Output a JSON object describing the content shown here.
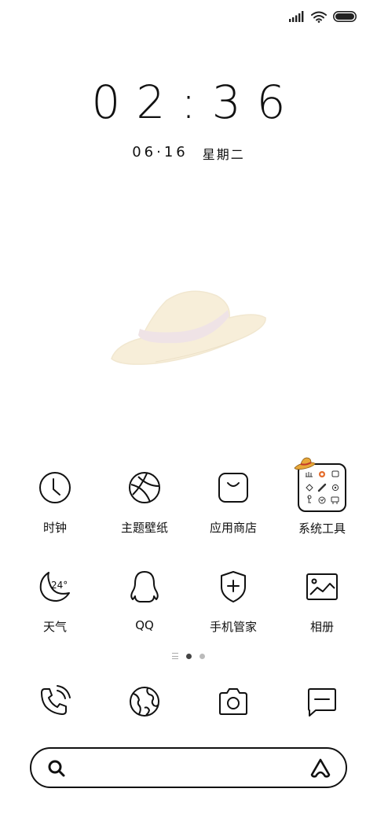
{
  "status_bar": {
    "signal_icon": "cellular-signal-icon",
    "wifi_icon": "wifi-icon",
    "battery_icon": "battery-icon"
  },
  "lock": {
    "time": "02:36",
    "date": "06·16",
    "weekday": "星期二"
  },
  "wallpaper": {
    "decoration": "straw-hat-icon",
    "colors": {
      "straw": "#f7eed9",
      "band": "#efe3e6"
    }
  },
  "apps": [
    {
      "label": "时钟",
      "icon": "clock-icon"
    },
    {
      "label": "主题壁纸",
      "icon": "theme-ball-icon"
    },
    {
      "label": "应用商店",
      "icon": "app-store-bag-icon"
    },
    {
      "label": "系统工具",
      "icon": "system-tools-folder-icon"
    },
    {
      "label": "天气",
      "icon": "weather-moon-icon",
      "badge": "24°"
    },
    {
      "label": "QQ",
      "icon": "qq-penguin-icon"
    },
    {
      "label": "手机管家",
      "icon": "security-shield-icon"
    },
    {
      "label": "相册",
      "icon": "gallery-icon"
    }
  ],
  "page_indicator": {
    "pages": 2,
    "current": 1
  },
  "dock": [
    {
      "icon": "phone-icon"
    },
    {
      "icon": "browser-globe-icon"
    },
    {
      "icon": "camera-icon"
    },
    {
      "icon": "messages-icon"
    }
  ],
  "search": {
    "placeholder": "",
    "left_icon": "search-icon",
    "right_icon": "assistant-icon"
  }
}
